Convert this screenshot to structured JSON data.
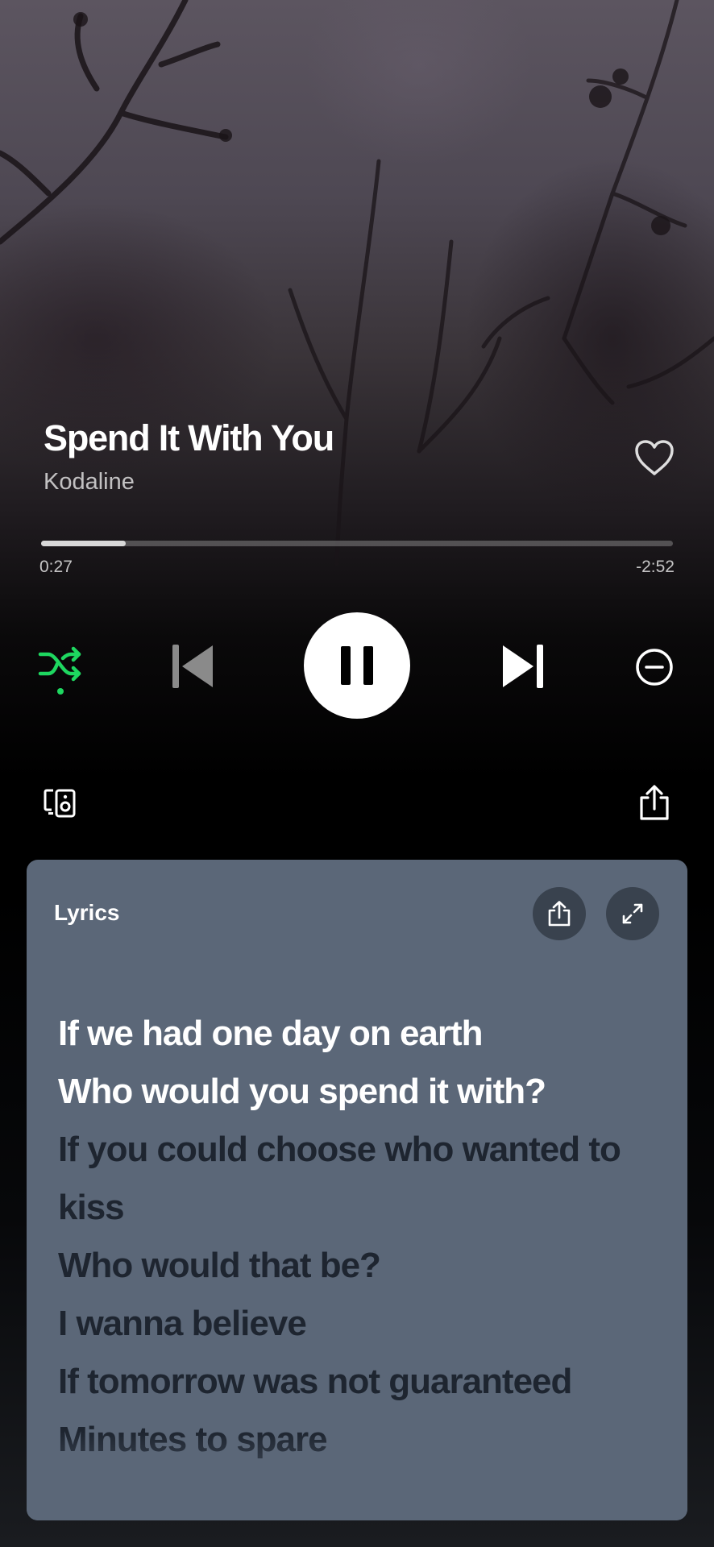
{
  "track": {
    "title": "Spend It With You",
    "artist": "Kodaline"
  },
  "playback": {
    "elapsed": "0:27",
    "remaining": "-2:52",
    "progress_fraction": 0.134,
    "is_playing": true,
    "shuffle_on": true
  },
  "icons": {
    "like": "heart-outline-icon",
    "shuffle": "shuffle-icon",
    "previous": "skip-previous-icon",
    "pause": "pause-icon",
    "next": "skip-next-icon",
    "remove": "minus-circle-icon",
    "devices": "connect-device-icon",
    "share": "share-icon",
    "expand": "expand-icon"
  },
  "colors": {
    "accent": "#1ed760",
    "lyrics_card": "#5b6778",
    "lyric_active": "#ffffff",
    "lyric_inactive": "#1e2530"
  },
  "lyrics": {
    "header": "Lyrics",
    "lines": [
      "If we had one day on earth",
      "Who would you spend it with?",
      "If you could choose who wanted to",
      "kiss",
      "Who would that be?",
      "I wanna believe",
      "If tomorrow was not guaranteed",
      "Minutes to spare"
    ],
    "active_count": 2
  }
}
